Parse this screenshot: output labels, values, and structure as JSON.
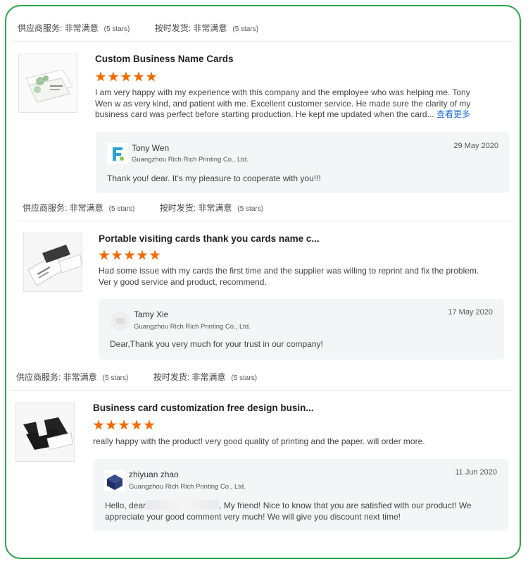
{
  "reviews": [
    {
      "supplier_service_label": "供应商服务: 非常满意",
      "supplier_service_stars": "(5 stars)",
      "shipping_label": "按时发货: 非常满意",
      "shipping_stars": "(5 stars)",
      "title": "Custom Business Name Cards",
      "rating": 5,
      "text": "I am very happy with my experience with this company and the employee who was helping me. Tony Wen w as very kind, and patient with me. Excellent customer service. He made sure the clarity of my business card was perfect before starting production. He kept me updated when the card...",
      "more_link": "查看更多",
      "reply": {
        "name": "Tony Wen",
        "company": "Guangzhou Rich Rich Printing Co., Ltd.",
        "date": "29 May 2020",
        "message": "Thank you! dear. It's my pleasure to cooperate with you!!!"
      }
    },
    {
      "supplier_service_label": "供应商服务: 非常满意",
      "supplier_service_stars": "(5 stars)",
      "shipping_label": "按时发货: 非常满意",
      "shipping_stars": "(5 stars)",
      "title": "Portable visiting cards thank you cards name c...",
      "rating": 5,
      "text": "Had some issue with my cards the first time and the supplier was willing to reprint and fix the problem. Ver y good service and product, recommend.",
      "reply": {
        "name": "Tamy Xie",
        "company": "Guangzhou Rich Rich Printing Co., Ltd.",
        "date": "17 May 2020",
        "message": "Dear,Thank you very much for your trust in our company!"
      }
    },
    {
      "supplier_service_label": "供应商服务: 非常满意",
      "supplier_service_stars": "(5 stars)",
      "shipping_label": "按时发货: 非常满意",
      "shipping_stars": "(5 stars)",
      "title": "Business card customization free design busin...",
      "rating": 5,
      "text": "really happy with the product! very good quality of printing and the paper. will order more.",
      "reply": {
        "name": "zhiyuan zhao",
        "company": "Guangzhou Rich Rich Printing Co., Ltd.",
        "date": "11 Jun 2020",
        "message_prefix": "Hello, dear",
        "message_suffix": ", My friend! Nice to know that you are satisfied with our product! We appreciate your good comment very much! We will give you discount next time!"
      }
    }
  ],
  "colors": {
    "frame": "#2fa34a",
    "star": "#f26a00",
    "link": "#1a6ed8",
    "reply_bg": "#f4f5f7"
  }
}
